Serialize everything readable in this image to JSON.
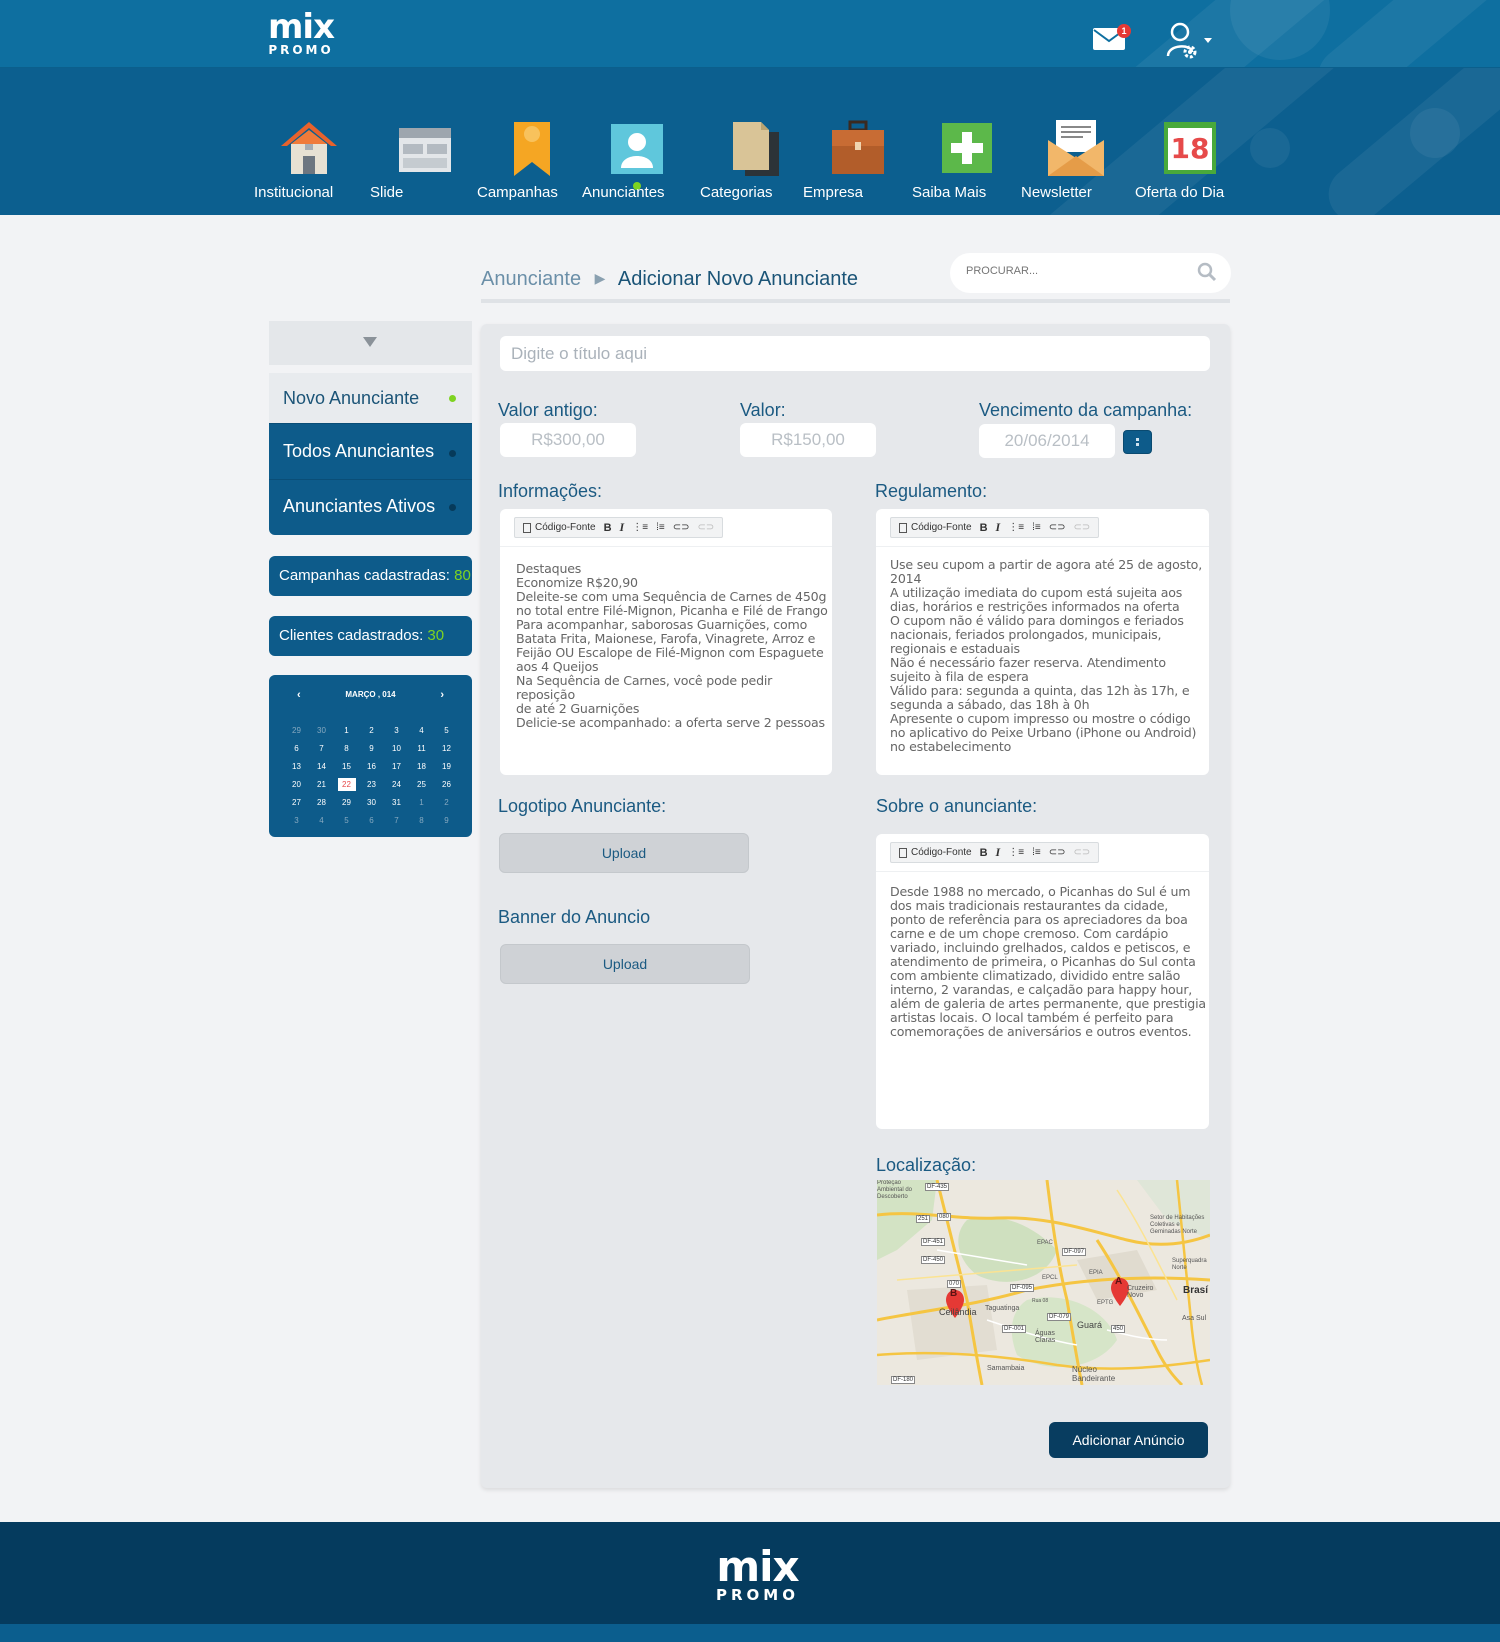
{
  "brand": {
    "logo_top": "mix",
    "logo_bottom": "PROMO",
    "accent": "#7ed321",
    "primary": "#0d5b8a"
  },
  "header": {
    "mail_icon": "envelope-icon",
    "mail_badge": "1",
    "user_icon": "user-gear-icon"
  },
  "nav": [
    {
      "label": "Institucional",
      "icon": "house-icon"
    },
    {
      "label": "Slide",
      "icon": "slides-icon"
    },
    {
      "label": "Campanhas",
      "icon": "bookmark-icon"
    },
    {
      "label": "Anunciantes",
      "icon": "person-icon",
      "active": true
    },
    {
      "label": "Categorias",
      "icon": "documents-icon"
    },
    {
      "label": "Empresa",
      "icon": "briefcase-icon"
    },
    {
      "label": "Saiba Mais",
      "icon": "plus-icon"
    },
    {
      "label": "Newsletter",
      "icon": "open-envelope-icon"
    },
    {
      "label": "Oferta do Dia",
      "icon": "calendar-icon",
      "day": "18"
    }
  ],
  "breadcrumb": {
    "parent": "Anunciante",
    "current": "Adicionar Novo Anunciante"
  },
  "search": {
    "placeholder": "PROCURAR..."
  },
  "sidebar": {
    "items": [
      {
        "label": "Novo Anunciante",
        "active": true
      },
      {
        "label": "Todos Anunciantes"
      },
      {
        "label": "Anunciantes Ativos"
      }
    ],
    "stats": [
      {
        "label": "Campanhas cadastradas: ",
        "value": "80"
      },
      {
        "label": "Clientes cadastrados: ",
        "value": "30"
      }
    ]
  },
  "calendar": {
    "title": "MARÇO , 014",
    "prev": "‹",
    "next": "›",
    "weeks": [
      [
        "29",
        "30",
        "1",
        "2",
        "3",
        "4",
        "5"
      ],
      [
        "6",
        "7",
        "8",
        "9",
        "10",
        "11",
        "12"
      ],
      [
        "13",
        "14",
        "15",
        "16",
        "17",
        "18",
        "19"
      ],
      [
        "20",
        "21",
        "22",
        "23",
        "24",
        "25",
        "26"
      ],
      [
        "27",
        "28",
        "29",
        "30",
        "31",
        "1",
        "2"
      ],
      [
        "3",
        "4",
        "5",
        "6",
        "7",
        "8",
        "9"
      ]
    ],
    "today": "22"
  },
  "form": {
    "title_placeholder": "Digite o título aqui",
    "old_price_label": "Valor antigo:",
    "old_price": "R$300,00",
    "price_label": "Valor:",
    "price": "R$150,00",
    "expiry_label": "Vencimento da campanha:",
    "expiry": "20/06/2014",
    "info_label": "Informações:",
    "rules_label": "Regulamento:",
    "logo_label": "Logotipo Anunciante:",
    "banner_label": "Banner do Anuncio",
    "upload": "Upload",
    "about_label": "Sobre o anunciante:",
    "location_label": "Localização:",
    "submit": "Adicionar Anúncio"
  },
  "toolbar": {
    "source": "Código-Fonte",
    "bold": "B",
    "italic": "I"
  },
  "info_lines": [
    "Destaques",
    "Economize R$20,90",
    "Deleite-se com uma Sequência de Carnes de 450g",
    "no total entre Filé-Mignon, Picanha e Filé de Frango",
    "Para acompanhar, saborosas Guarnições, como",
    "Batata Frita, Maionese, Farofa, Vinagrete, Arroz e",
    "Feijão OU Escalope de Filé-Mignon com Espaguete",
    "aos 4 Queijos",
    "Na Sequência de Carnes, você pode pedir reposição",
    "de até 2 Guarnições",
    "Delicie-se acompanhado: a oferta serve 2 pessoas"
  ],
  "rules_lines": [
    "Use seu cupom a partir de agora até 25 de agosto,",
    "2014",
    "A utilização imediata do cupom está sujeita aos",
    "dias, horários e restrições informados na oferta",
    "O cupom não é válido para domingos e feriados",
    "nacionais, feriados prolongados, municipais,",
    "regionais e estaduais",
    "Não é necessário fazer reserva. Atendimento",
    "sujeito à fila de espera",
    "Válido para: segunda a quinta, das 12h às 17h, e",
    "segunda a sábado, das 18h à 0h",
    "Apresente o cupom impresso ou mostre o código",
    "no aplicativo do Peixe Urbano (iPhone ou Android)",
    "no estabelecimento"
  ],
  "about_lines": [
    "Desde 1988 no mercado, o Picanhas do Sul é um",
    "dos mais tradicionais restaurantes da cidade,",
    "ponto de referência para os apreciadores da boa",
    "carne e de um chope cremoso. Com cardápio",
    "variado, incluindo grelhados, caldos e petiscos, e",
    "atendimento de primeira, o Picanhas do Sul conta",
    "com ambiente climatizado, dividido entre salão",
    "interno, 2 varandas, e calçadão para happy hour,",
    "além de galeria de artes permanente, que prestigia",
    "artistas locais. O local também é perfeito para",
    "comemorações de aniversários e outros eventos."
  ],
  "map": {
    "markers": [
      "A",
      "B"
    ],
    "labels": [
      "Ceilândia",
      "Taguatinga",
      "Águas Claras",
      "Guará",
      "Cruzeiro Novo",
      "Brasí",
      "Núcleo Bandeirante",
      "Samambaia",
      "Asa Sul",
      "EPAC",
      "EPCL",
      "EPTG",
      "EPIA",
      "Setor de Habitações Coletivas e Geminadas Norte",
      "Superquadra Norte",
      "Proteção Ambiental do Descoberto",
      "Rua 08"
    ],
    "roads": [
      "DF-435",
      "251",
      "080",
      "DF-451",
      "DF-450",
      "DF-095",
      "DF-097",
      "DF-079",
      "DF-001",
      "DF-180",
      "450",
      "070"
    ]
  }
}
